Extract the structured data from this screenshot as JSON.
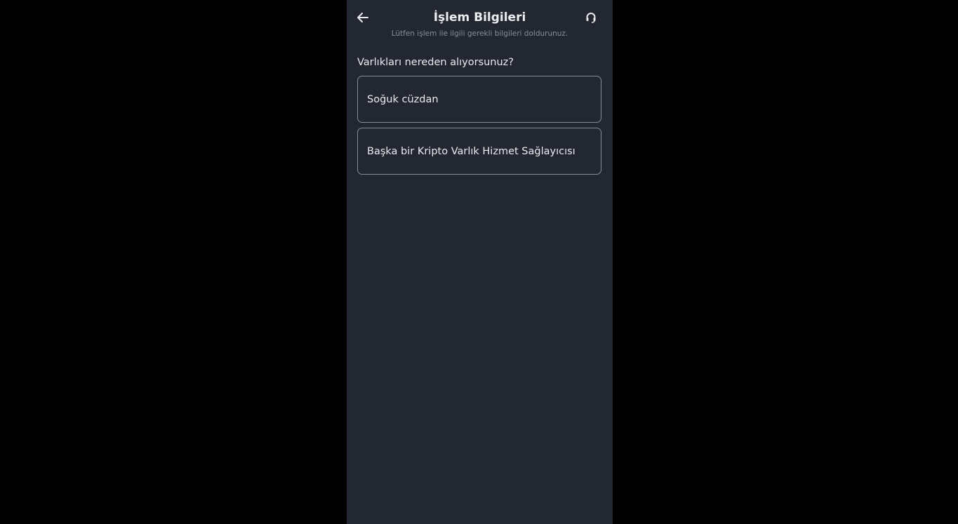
{
  "header": {
    "title": "İşlem Bilgileri",
    "subtitle": "Lütfen işlem ile ilgili gerekli bilgileri doldurunuz.",
    "back_icon": "arrow-left-icon",
    "support_icon": "headset-icon"
  },
  "form": {
    "question": "Varlıkları nereden alıyorsunuz?",
    "options": [
      {
        "label": "Soğuk cüzdan"
      },
      {
        "label": "Başka bir Kripto Varlık Hizmet Sağlayıcısı"
      }
    ]
  },
  "colors": {
    "background": "#222731",
    "outer": "#000000",
    "text": "#eaecef",
    "muted": "#848e9c",
    "border": "#848e9c"
  }
}
